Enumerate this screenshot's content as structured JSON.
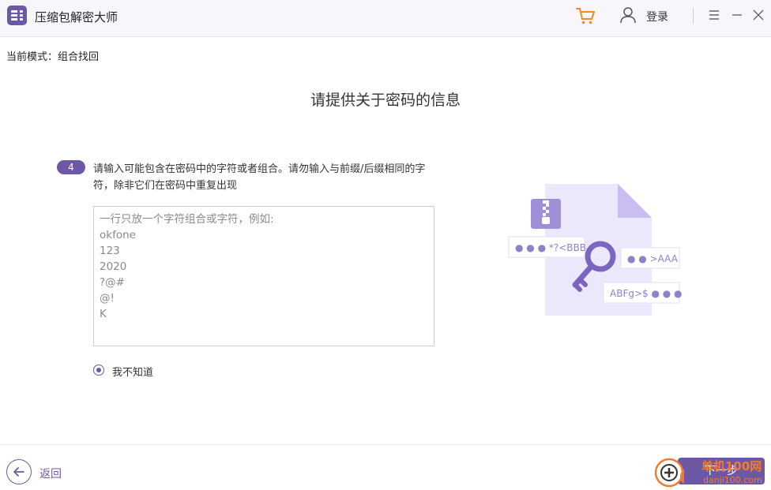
{
  "app": {
    "title": "压缩包解密大师"
  },
  "header": {
    "login_label": "登录"
  },
  "mode": {
    "label": "当前模式：组合找回"
  },
  "page": {
    "heading": "请提供关于密码的信息"
  },
  "step": {
    "number": "4",
    "instruction": "请输入可能包含在密码中的字符或者组合。请勿输入与前缀/后缀相同的字符，除非它们在密码中重复出现"
  },
  "input": {
    "lines": [
      "一行只放一个字符组合或字符，例如:",
      "okfone",
      "123",
      "2020",
      "?@#",
      "@!",
      "K"
    ]
  },
  "option": {
    "label": "我不知道",
    "selected": true
  },
  "illustration": {
    "tag1": "● ● ●  *?<BBB",
    "tag2": "● ●  >AAA",
    "tag3": "ABFg>$ ● ● ●"
  },
  "footer": {
    "back_label": "返回",
    "next_label": "下一步"
  },
  "watermark": {
    "text": "单机100网",
    "url": "danji100.com"
  },
  "colors": {
    "accent": "#6d58a6",
    "cart": "#f28a22",
    "watermark": "#f47b2b"
  },
  "icons": [
    "app-logo-icon",
    "cart-icon",
    "user-icon",
    "menu-icon",
    "minimize-icon",
    "close-icon",
    "zip-file-icon",
    "key-icon",
    "back-arrow-icon"
  ]
}
